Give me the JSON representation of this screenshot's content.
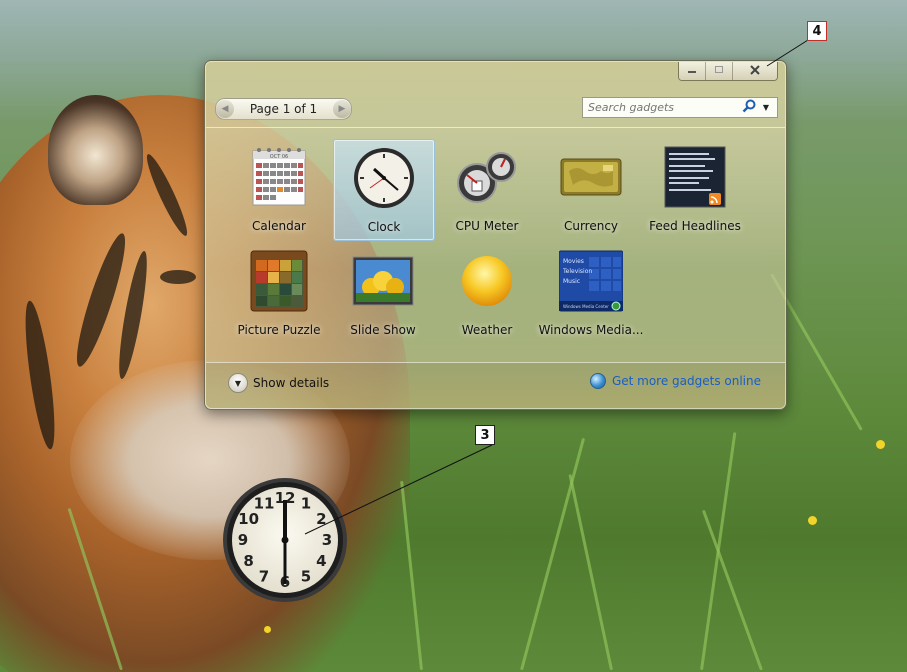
{
  "window": {
    "minimize_icon": "minimize-icon",
    "maximize_icon": "maximize-icon",
    "close_icon": "close-icon"
  },
  "toolbar": {
    "page_label": "Page 1 of 1",
    "search_placeholder": "Search gadgets"
  },
  "gadgets": [
    {
      "label": "Calendar",
      "icon": "calendar-icon",
      "selected": false
    },
    {
      "label": "Clock",
      "icon": "clock-icon",
      "selected": true
    },
    {
      "label": "CPU Meter",
      "icon": "cpu-meter-icon",
      "selected": false
    },
    {
      "label": "Currency",
      "icon": "currency-icon",
      "selected": false
    },
    {
      "label": "Feed Headlines",
      "icon": "feed-headlines-icon",
      "selected": false
    },
    {
      "label": "Picture Puzzle",
      "icon": "picture-puzzle-icon",
      "selected": false
    },
    {
      "label": "Slide Show",
      "icon": "slide-show-icon",
      "selected": false
    },
    {
      "label": "Weather",
      "icon": "weather-icon",
      "selected": false
    },
    {
      "label": "Windows Media...",
      "icon": "windows-media-center-icon",
      "selected": false
    }
  ],
  "calendar_thumb": {
    "month": "OCT 06"
  },
  "media_thumb": {
    "items": [
      "Movies",
      "Television",
      "Music"
    ],
    "footer": "Windows Media Center"
  },
  "footer": {
    "details_label": "Show details",
    "online_label": "Get more gadgets online"
  },
  "callouts": {
    "desktop_clock": "3",
    "close_button": "4"
  },
  "desktop_clock": {
    "numbers": [
      "12",
      "1",
      "2",
      "3",
      "4",
      "5",
      "6",
      "7",
      "8",
      "9",
      "10",
      "11"
    ]
  },
  "colors": {
    "accent_link": "#1a5ec4",
    "selected_tile": "#b9d7ea",
    "callout_red": "#c0302a"
  }
}
